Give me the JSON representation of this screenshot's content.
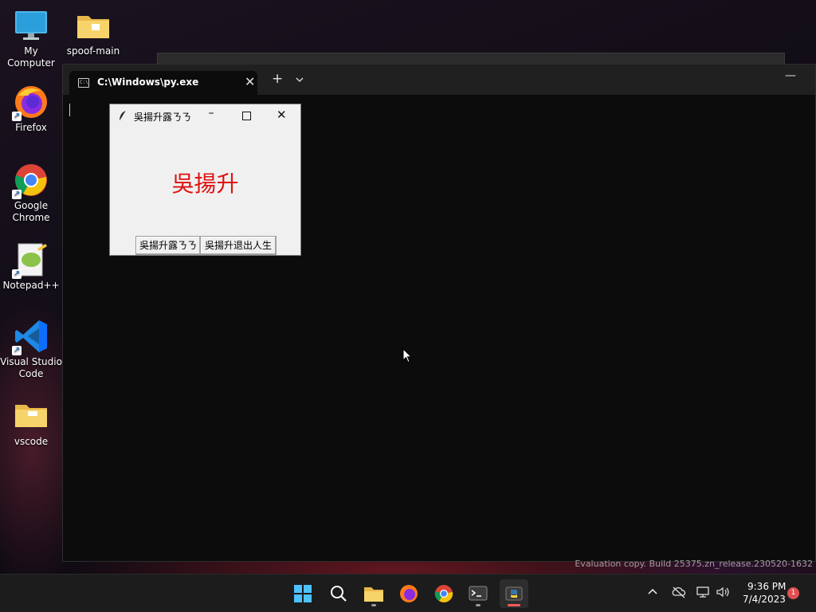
{
  "desktop": {
    "icons": [
      {
        "label": "My Computer"
      },
      {
        "label": "spoof-main"
      },
      {
        "label": "Firefox"
      },
      {
        "label": "Google Chrome"
      },
      {
        "label": "Notepad++"
      },
      {
        "label": "Visual Studio Code"
      },
      {
        "label": "vscode"
      }
    ],
    "watermark": "Evaluation copy. Build 25375.zn_release.230520-1632"
  },
  "terminal": {
    "tab_title": "C:\\Windows\\py.exe",
    "tab_icon_text": "C:\\",
    "new_tab_symbol": "+",
    "dropdown_symbol": "⌄",
    "close_symbol": "✕",
    "minimize_symbol": "—"
  },
  "tk_window": {
    "title": "吳揚升露ㄋㄋ",
    "label": "吳揚升",
    "label_color": "#e01010",
    "buttons": [
      {
        "label": "吳揚升露ㄋㄋ"
      },
      {
        "label": "吳揚升退出人生"
      }
    ],
    "min_symbol": "–",
    "close_symbol": "✕"
  },
  "taskbar": {
    "items": [
      "start-icon",
      "search-icon",
      "file-explorer-icon",
      "firefox-icon",
      "chrome-icon",
      "terminal-icon",
      "python-icon"
    ],
    "tray": {
      "time": "9:36 PM",
      "date": "7/4/2023",
      "notification_count": "1",
      "chevron": "^"
    }
  }
}
